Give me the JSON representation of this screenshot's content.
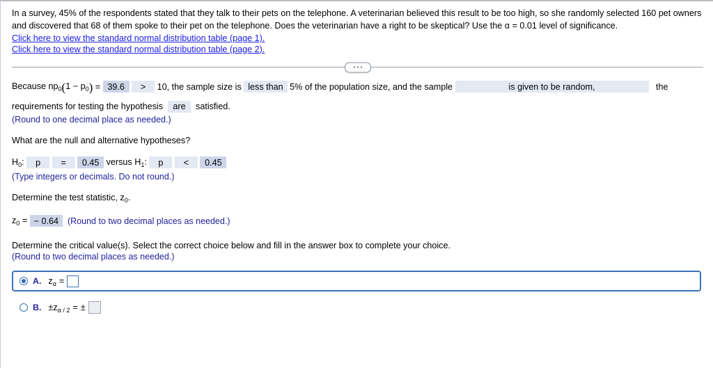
{
  "problem": {
    "text": "In a survey, 45% of the respondents stated that they talk to their pets on the telephone. A veterinarian believed this result to be too high, so she randomly selected 160 pet owners and discovered that 68 of them spoke to their pet on the telephone. Does the veterinarian have a right to be skeptical? Use the α = 0.01 level of significance.",
    "link_page1": "Click here to view the standard normal distribution table (page 1).",
    "link_page2": "Click here to view the standard normal distribution table (page 2)."
  },
  "divider": {
    "handle_icon": "ellipsis-handle"
  },
  "conditions": {
    "lead": "Because np",
    "sub0": "0",
    "open_paren": "(",
    "one_minus": "1 − p",
    "close_paren": ")",
    "equals": "=",
    "np_value": "39.6",
    "comparison": ">",
    "after_comparison": "10, the sample size is",
    "sample_size_choice": "less than",
    "after_sample_size": "5% of the population size, and the sample",
    "randomness_choice": "is given to be random,",
    "trailing_the": "the",
    "line2_lead": "requirements for testing the hypothesis",
    "are_choice": "are",
    "line2_tail": "satisfied.",
    "round_note": "(Round to one decimal place as needed.)"
  },
  "hypotheses": {
    "question": "What are the null and alternative hypotheses?",
    "h0_label": "H",
    "h0_sub": "0",
    "colon": ":",
    "h0_param": "p",
    "h0_operator": "=",
    "h0_value": "0.45",
    "versus": "versus H",
    "h1_sub": "1",
    "h1_param": "p",
    "h1_operator": "<",
    "h1_value": "0.45",
    "note": "(Type integers or decimals. Do not round.)"
  },
  "test_statistic": {
    "prompt_lead": "Determine the test statistic, z",
    "prompt_sub": "0",
    "prompt_end": ".",
    "z_label": "z",
    "z_sub": "0",
    "equals": "=",
    "value": "− 0.64",
    "note": "(Round to two decimal places as needed.)"
  },
  "critical_value": {
    "prompt": "Determine the critical value(s). Select the correct choice below and fill in the answer box to complete your choice.",
    "note": "(Round to two decimal places as needed.)",
    "choices": [
      {
        "letter": "A.",
        "selected": true,
        "math_base": "z",
        "math_sub": "α",
        "math_equals": "=",
        "answer_value": "",
        "answer_enabled": true
      },
      {
        "letter": "B.",
        "selected": false,
        "math_prefix": "±",
        "math_base": "z",
        "math_sub": "α / 2",
        "math_equals": "=",
        "math_pm": "±",
        "answer_value": "",
        "answer_enabled": false
      }
    ]
  },
  "colors": {
    "link": "#1a1ae6",
    "note_blue": "#23239e",
    "field_bg": "#ccd5e8",
    "dropdown_bg": "#e3e9f3",
    "selection_border": "#3a72b8"
  }
}
